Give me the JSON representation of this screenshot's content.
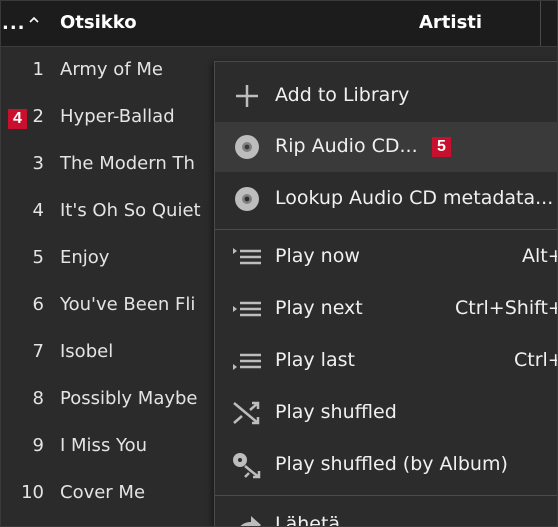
{
  "header": {
    "ellipsis": "...",
    "title_col": "Otsikko",
    "artist_col": "Artisti"
  },
  "tracks": [
    {
      "num": "1",
      "title": "Army of Me"
    },
    {
      "num": "2",
      "title": "Hyper-Ballad"
    },
    {
      "num": "3",
      "title": "The Modern Th"
    },
    {
      "num": "4",
      "title": "It's Oh So Quiet"
    },
    {
      "num": "5",
      "title": "Enjoy"
    },
    {
      "num": "6",
      "title": "You've Been Fli"
    },
    {
      "num": "7",
      "title": "Isobel"
    },
    {
      "num": "8",
      "title": "Possibly Maybe"
    },
    {
      "num": "9",
      "title": "I Miss You"
    },
    {
      "num": "10",
      "title": "Cover Me"
    }
  ],
  "callouts": {
    "row_marker": "4",
    "rip_marker": "5"
  },
  "menu": {
    "items": [
      {
        "label": "Add to Library",
        "icon": "plus-icon",
        "shortcut": ""
      },
      {
        "label": "Rip Audio CD...",
        "icon": "cd-icon",
        "shortcut": ""
      },
      {
        "label": "Lookup Audio CD metadata...",
        "icon": "cd-icon",
        "shortcut": ""
      },
      {
        "label": "Play now",
        "icon": "play-now-icon",
        "shortcut": "Alt+"
      },
      {
        "label": "Play next",
        "icon": "play-next-icon",
        "shortcut": "Ctrl+Shift+"
      },
      {
        "label": "Play last",
        "icon": "play-last-icon",
        "shortcut": "Ctrl+"
      },
      {
        "label": "Play shuffled",
        "icon": "shuffle-icon",
        "shortcut": ""
      },
      {
        "label": "Play shuffled (by Album)",
        "icon": "shuffle-album-icon",
        "shortcut": ""
      },
      {
        "label": "Lähetä",
        "icon": "send-icon",
        "shortcut": ""
      }
    ]
  },
  "colors": {
    "background": "#2b2b2b",
    "header": "#1c1c1c",
    "menu": "#2c2c2c",
    "highlight": "#3a3a3a",
    "callout": "#c8102e",
    "icon": "#bdbdbd"
  }
}
